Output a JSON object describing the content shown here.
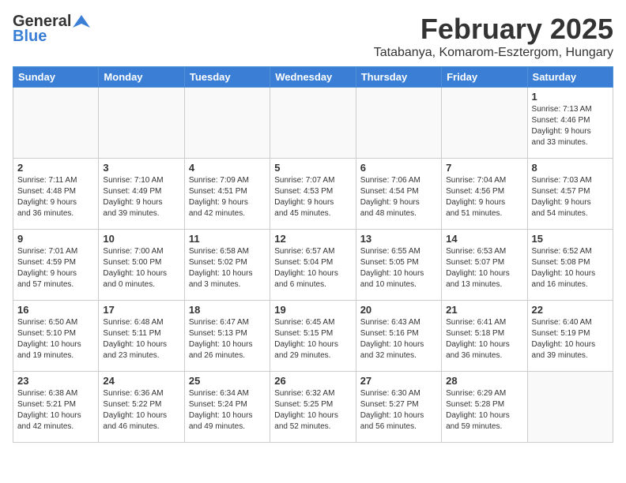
{
  "header": {
    "logo_general": "General",
    "logo_blue": "Blue",
    "month": "February 2025",
    "location": "Tatabanya, Komarom-Esztergom, Hungary"
  },
  "weekdays": [
    "Sunday",
    "Monday",
    "Tuesday",
    "Wednesday",
    "Thursday",
    "Friday",
    "Saturday"
  ],
  "weeks": [
    [
      {
        "day": "",
        "info": ""
      },
      {
        "day": "",
        "info": ""
      },
      {
        "day": "",
        "info": ""
      },
      {
        "day": "",
        "info": ""
      },
      {
        "day": "",
        "info": ""
      },
      {
        "day": "",
        "info": ""
      },
      {
        "day": "1",
        "info": "Sunrise: 7:13 AM\nSunset: 4:46 PM\nDaylight: 9 hours\nand 33 minutes."
      }
    ],
    [
      {
        "day": "2",
        "info": "Sunrise: 7:11 AM\nSunset: 4:48 PM\nDaylight: 9 hours\nand 36 minutes."
      },
      {
        "day": "3",
        "info": "Sunrise: 7:10 AM\nSunset: 4:49 PM\nDaylight: 9 hours\nand 39 minutes."
      },
      {
        "day": "4",
        "info": "Sunrise: 7:09 AM\nSunset: 4:51 PM\nDaylight: 9 hours\nand 42 minutes."
      },
      {
        "day": "5",
        "info": "Sunrise: 7:07 AM\nSunset: 4:53 PM\nDaylight: 9 hours\nand 45 minutes."
      },
      {
        "day": "6",
        "info": "Sunrise: 7:06 AM\nSunset: 4:54 PM\nDaylight: 9 hours\nand 48 minutes."
      },
      {
        "day": "7",
        "info": "Sunrise: 7:04 AM\nSunset: 4:56 PM\nDaylight: 9 hours\nand 51 minutes."
      },
      {
        "day": "8",
        "info": "Sunrise: 7:03 AM\nSunset: 4:57 PM\nDaylight: 9 hours\nand 54 minutes."
      }
    ],
    [
      {
        "day": "9",
        "info": "Sunrise: 7:01 AM\nSunset: 4:59 PM\nDaylight: 9 hours\nand 57 minutes."
      },
      {
        "day": "10",
        "info": "Sunrise: 7:00 AM\nSunset: 5:00 PM\nDaylight: 10 hours\nand 0 minutes."
      },
      {
        "day": "11",
        "info": "Sunrise: 6:58 AM\nSunset: 5:02 PM\nDaylight: 10 hours\nand 3 minutes."
      },
      {
        "day": "12",
        "info": "Sunrise: 6:57 AM\nSunset: 5:04 PM\nDaylight: 10 hours\nand 6 minutes."
      },
      {
        "day": "13",
        "info": "Sunrise: 6:55 AM\nSunset: 5:05 PM\nDaylight: 10 hours\nand 10 minutes."
      },
      {
        "day": "14",
        "info": "Sunrise: 6:53 AM\nSunset: 5:07 PM\nDaylight: 10 hours\nand 13 minutes."
      },
      {
        "day": "15",
        "info": "Sunrise: 6:52 AM\nSunset: 5:08 PM\nDaylight: 10 hours\nand 16 minutes."
      }
    ],
    [
      {
        "day": "16",
        "info": "Sunrise: 6:50 AM\nSunset: 5:10 PM\nDaylight: 10 hours\nand 19 minutes."
      },
      {
        "day": "17",
        "info": "Sunrise: 6:48 AM\nSunset: 5:11 PM\nDaylight: 10 hours\nand 23 minutes."
      },
      {
        "day": "18",
        "info": "Sunrise: 6:47 AM\nSunset: 5:13 PM\nDaylight: 10 hours\nand 26 minutes."
      },
      {
        "day": "19",
        "info": "Sunrise: 6:45 AM\nSunset: 5:15 PM\nDaylight: 10 hours\nand 29 minutes."
      },
      {
        "day": "20",
        "info": "Sunrise: 6:43 AM\nSunset: 5:16 PM\nDaylight: 10 hours\nand 32 minutes."
      },
      {
        "day": "21",
        "info": "Sunrise: 6:41 AM\nSunset: 5:18 PM\nDaylight: 10 hours\nand 36 minutes."
      },
      {
        "day": "22",
        "info": "Sunrise: 6:40 AM\nSunset: 5:19 PM\nDaylight: 10 hours\nand 39 minutes."
      }
    ],
    [
      {
        "day": "23",
        "info": "Sunrise: 6:38 AM\nSunset: 5:21 PM\nDaylight: 10 hours\nand 42 minutes."
      },
      {
        "day": "24",
        "info": "Sunrise: 6:36 AM\nSunset: 5:22 PM\nDaylight: 10 hours\nand 46 minutes."
      },
      {
        "day": "25",
        "info": "Sunrise: 6:34 AM\nSunset: 5:24 PM\nDaylight: 10 hours\nand 49 minutes."
      },
      {
        "day": "26",
        "info": "Sunrise: 6:32 AM\nSunset: 5:25 PM\nDaylight: 10 hours\nand 52 minutes."
      },
      {
        "day": "27",
        "info": "Sunrise: 6:30 AM\nSunset: 5:27 PM\nDaylight: 10 hours\nand 56 minutes."
      },
      {
        "day": "28",
        "info": "Sunrise: 6:29 AM\nSunset: 5:28 PM\nDaylight: 10 hours\nand 59 minutes."
      },
      {
        "day": "",
        "info": ""
      }
    ]
  ]
}
